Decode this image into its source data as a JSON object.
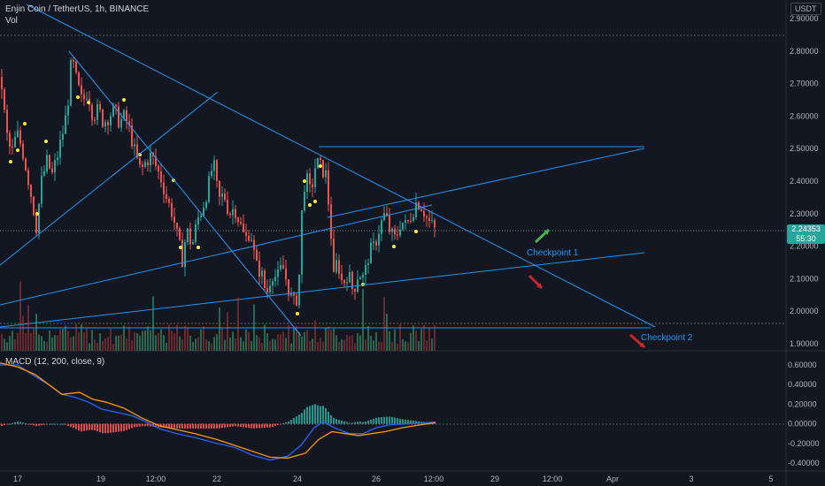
{
  "header": {
    "symbol_line": "Enjin Coin / TetherUS, 1h, BINANCE",
    "vol_label": "Vol",
    "currency": "USDT"
  },
  "last_price": {
    "value": "2.24353",
    "countdown": "55:30"
  },
  "annotations": {
    "checkpoint1": "Checkpoint 1",
    "checkpoint2": "Checkpoint 2"
  },
  "colors": {
    "background": "#131722",
    "up": "#26a69a",
    "down": "#ef5350",
    "trendline": "#2196f3",
    "macd": "#2962ff",
    "signal": "#ff9800",
    "marker": "#ffeb3b",
    "arrow_up": "#4caf50",
    "arrow_down": "#c62828"
  },
  "chart_data": [
    {
      "type": "candlestick",
      "title": "Enjin Coin / TetherUS, 1h, BINANCE",
      "y_axis": {
        "ticks": [
          2.9,
          2.8,
          2.7,
          2.6,
          2.5,
          2.4,
          2.3,
          2.2,
          2.1,
          2.0,
          1.9
        ],
        "tick_labels": [
          "2.90000",
          "2.80000",
          "2.70000",
          "2.60000",
          "2.50000",
          "2.40000",
          "2.30000",
          "2.20000",
          "2.10000",
          "2.00000",
          "1.90000"
        ],
        "ylim": [
          1.87,
          2.94
        ]
      },
      "x_axis": {
        "tick_labels": [
          "17",
          "19",
          "12:00",
          "22",
          "24",
          "26",
          "12:00",
          "29",
          "12:00",
          "Apr",
          "3",
          "5"
        ]
      },
      "close_path": [
        [
          0,
          2.72
        ],
        [
          6,
          2.55
        ],
        [
          12,
          2.48
        ],
        [
          18,
          2.55
        ],
        [
          24,
          2.5
        ],
        [
          30,
          2.42
        ],
        [
          36,
          2.33
        ],
        [
          40,
          2.26
        ],
        [
          46,
          2.4
        ],
        [
          52,
          2.46
        ],
        [
          58,
          2.42
        ],
        [
          64,
          2.48
        ],
        [
          70,
          2.55
        ],
        [
          75,
          2.62
        ],
        [
          80,
          2.78
        ],
        [
          86,
          2.7
        ],
        [
          92,
          2.64
        ],
        [
          98,
          2.68
        ],
        [
          104,
          2.6
        ],
        [
          110,
          2.62
        ],
        [
          116,
          2.58
        ],
        [
          122,
          2.6
        ],
        [
          128,
          2.62
        ],
        [
          134,
          2.58
        ],
        [
          140,
          2.6
        ],
        [
          146,
          2.55
        ],
        [
          152,
          2.48
        ],
        [
          158,
          2.43
        ],
        [
          164,
          2.46
        ],
        [
          170,
          2.48
        ],
        [
          176,
          2.44
        ],
        [
          182,
          2.4
        ],
        [
          188,
          2.34
        ],
        [
          194,
          2.3
        ],
        [
          200,
          2.22
        ],
        [
          205,
          2.16
        ],
        [
          210,
          2.25
        ],
        [
          216,
          2.2
        ],
        [
          222,
          2.28
        ],
        [
          228,
          2.32
        ],
        [
          234,
          2.38
        ],
        [
          240,
          2.46
        ],
        [
          246,
          2.34
        ],
        [
          252,
          2.36
        ],
        [
          258,
          2.3
        ],
        [
          264,
          2.32
        ],
        [
          270,
          2.27
        ],
        [
          276,
          2.22
        ],
        [
          282,
          2.25
        ],
        [
          288,
          2.14
        ],
        [
          294,
          2.12
        ],
        [
          300,
          2.05
        ],
        [
          306,
          2.12
        ],
        [
          312,
          2.1
        ],
        [
          318,
          2.14
        ],
        [
          324,
          2.08
        ],
        [
          330,
          2.02
        ],
        [
          336,
          2.05
        ],
        [
          340,
          2.3
        ],
        [
          344,
          2.42
        ],
        [
          350,
          2.36
        ],
        [
          356,
          2.46
        ],
        [
          362,
          2.44
        ],
        [
          367,
          2.42
        ],
        [
          372,
          2.28
        ],
        [
          376,
          2.1
        ],
        [
          380,
          2.16
        ],
        [
          386,
          2.08
        ],
        [
          392,
          2.12
        ],
        [
          398,
          2.06
        ],
        [
          404,
          2.12
        ],
        [
          410,
          2.1
        ],
        [
          416,
          2.18
        ],
        [
          422,
          2.2
        ],
        [
          428,
          2.26
        ],
        [
          434,
          2.3
        ],
        [
          440,
          2.24
        ],
        [
          446,
          2.22
        ],
        [
          452,
          2.28
        ],
        [
          458,
          2.26
        ],
        [
          464,
          2.3
        ],
        [
          470,
          2.34
        ],
        [
          476,
          2.32
        ],
        [
          482,
          2.28
        ],
        [
          488,
          2.26
        ],
        [
          492,
          2.24
        ]
      ],
      "last_price": 2.24353
    },
    {
      "type": "macd",
      "title": "MACD (12, 200, close, 9)",
      "y_axis": {
        "ticks": [
          0.6,
          0.4,
          0.2,
          0.0,
          -0.2,
          -0.4
        ],
        "tick_labels": [
          "0.60000",
          "0.40000",
          "0.20000",
          "0.00000",
          "-0.20000",
          "-0.40000"
        ],
        "ylim": [
          -0.48,
          0.66
        ]
      },
      "macd": [
        [
          0,
          0.6
        ],
        [
          20,
          0.6
        ],
        [
          40,
          0.48
        ],
        [
          55,
          0.4
        ],
        [
          70,
          0.3
        ],
        [
          85,
          0.27
        ],
        [
          100,
          0.22
        ],
        [
          115,
          0.15
        ],
        [
          130,
          0.12
        ],
        [
          150,
          0.08
        ],
        [
          165,
          0.02
        ],
        [
          180,
          -0.05
        ],
        [
          200,
          -0.1
        ],
        [
          220,
          -0.14
        ],
        [
          245,
          -0.2
        ],
        [
          265,
          -0.24
        ],
        [
          285,
          -0.32
        ],
        [
          305,
          -0.37
        ],
        [
          325,
          -0.33
        ],
        [
          340,
          -0.22
        ],
        [
          355,
          -0.04
        ],
        [
          365,
          0.02
        ],
        [
          380,
          -0.05
        ],
        [
          395,
          -0.1
        ],
        [
          410,
          -0.1
        ],
        [
          425,
          -0.04
        ],
        [
          440,
          -0.01
        ],
        [
          460,
          0.0
        ],
        [
          480,
          0.01
        ],
        [
          492,
          0.02
        ]
      ],
      "signal": [
        [
          0,
          0.62
        ],
        [
          20,
          0.58
        ],
        [
          40,
          0.5
        ],
        [
          55,
          0.4
        ],
        [
          70,
          0.3
        ],
        [
          90,
          0.32
        ],
        [
          105,
          0.25
        ],
        [
          120,
          0.22
        ],
        [
          140,
          0.16
        ],
        [
          160,
          0.06
        ],
        [
          180,
          -0.02
        ],
        [
          200,
          -0.06
        ],
        [
          220,
          -0.1
        ],
        [
          245,
          -0.16
        ],
        [
          265,
          -0.22
        ],
        [
          285,
          -0.28
        ],
        [
          305,
          -0.34
        ],
        [
          325,
          -0.35
        ],
        [
          345,
          -0.3
        ],
        [
          360,
          -0.16
        ],
        [
          375,
          -0.08
        ],
        [
          390,
          -0.1
        ],
        [
          405,
          -0.12
        ],
        [
          420,
          -0.1
        ],
        [
          435,
          -0.08
        ],
        [
          455,
          -0.04
        ],
        [
          475,
          -0.01
        ],
        [
          492,
          0.01
        ]
      ]
    }
  ]
}
